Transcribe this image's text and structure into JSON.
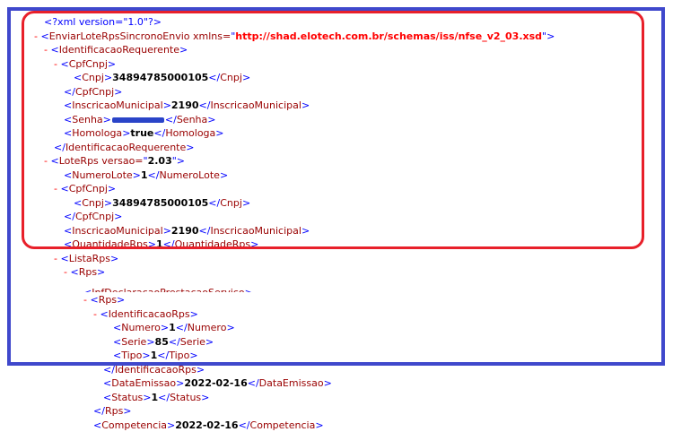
{
  "xml_declaration": "<?xml version=\"1.0\"?>",
  "lines": [
    {
      "indent": 0,
      "minus": false,
      "parts": [
        {
          "t": "pi",
          "v": "<?xml version=\"1.0\"?>"
        }
      ]
    },
    {
      "indent": 0,
      "minus": true,
      "parts": [
        {
          "t": "br",
          "v": "<"
        },
        {
          "t": "tg",
          "v": "EnviarLoteRpsSincronoEnvio"
        },
        {
          "t": "at",
          "v": " xmlns="
        },
        {
          "t": "av",
          "v": "\""
        },
        {
          "t": "avu",
          "v": "http://shad.elotech.com.br/schemas/iss/nfse_v2_03.xsd"
        },
        {
          "t": "av",
          "v": "\""
        },
        {
          "t": "br",
          "v": ">"
        }
      ]
    },
    {
      "indent": 1,
      "minus": true,
      "parts": [
        {
          "t": "br",
          "v": "<"
        },
        {
          "t": "tg",
          "v": "IdentificacaoRequerente"
        },
        {
          "t": "br",
          "v": ">"
        }
      ]
    },
    {
      "indent": 2,
      "minus": true,
      "parts": [
        {
          "t": "br",
          "v": "<"
        },
        {
          "t": "tg",
          "v": "CpfCnpj"
        },
        {
          "t": "br",
          "v": ">"
        }
      ]
    },
    {
      "indent": 3,
      "minus": false,
      "parts": [
        {
          "t": "br",
          "v": "<"
        },
        {
          "t": "tg",
          "v": "Cnpj"
        },
        {
          "t": "br",
          "v": ">"
        },
        {
          "t": "tx",
          "v": "34894785000105"
        },
        {
          "t": "br",
          "v": "</"
        },
        {
          "t": "tg",
          "v": "Cnpj"
        },
        {
          "t": "br",
          "v": ">"
        }
      ]
    },
    {
      "indent": 2,
      "minus": false,
      "parts": [
        {
          "t": "br",
          "v": "</"
        },
        {
          "t": "tg",
          "v": "CpfCnpj"
        },
        {
          "t": "br",
          "v": ">"
        }
      ]
    },
    {
      "indent": 2,
      "minus": false,
      "parts": [
        {
          "t": "br",
          "v": "<"
        },
        {
          "t": "tg",
          "v": "InscricaoMunicipal"
        },
        {
          "t": "br",
          "v": ">"
        },
        {
          "t": "tx",
          "v": "2190"
        },
        {
          "t": "br",
          "v": "</"
        },
        {
          "t": "tg",
          "v": "InscricaoMunicipal"
        },
        {
          "t": "br",
          "v": ">"
        }
      ]
    },
    {
      "indent": 2,
      "minus": false,
      "parts": [
        {
          "t": "br",
          "v": "<"
        },
        {
          "t": "tg",
          "v": "Senha"
        },
        {
          "t": "br",
          "v": ">"
        },
        {
          "t": "mask",
          "v": ""
        },
        {
          "t": "br",
          "v": "</"
        },
        {
          "t": "tg",
          "v": "Senha"
        },
        {
          "t": "br",
          "v": ">"
        }
      ]
    },
    {
      "indent": 2,
      "minus": false,
      "parts": [
        {
          "t": "br",
          "v": "<"
        },
        {
          "t": "tg",
          "v": "Homologa"
        },
        {
          "t": "br",
          "v": ">"
        },
        {
          "t": "tx",
          "v": "true"
        },
        {
          "t": "br",
          "v": "</"
        },
        {
          "t": "tg",
          "v": "Homologa"
        },
        {
          "t": "br",
          "v": ">"
        }
      ]
    },
    {
      "indent": 1,
      "minus": false,
      "parts": [
        {
          "t": "br",
          "v": "</"
        },
        {
          "t": "tg",
          "v": "IdentificacaoRequerente"
        },
        {
          "t": "br",
          "v": ">"
        }
      ]
    },
    {
      "indent": 1,
      "minus": true,
      "parts": [
        {
          "t": "br",
          "v": "<"
        },
        {
          "t": "tg",
          "v": "LoteRps"
        },
        {
          "t": "at",
          "v": " versao="
        },
        {
          "t": "av",
          "v": "\""
        },
        {
          "t": "tx",
          "v": "2.03"
        },
        {
          "t": "av",
          "v": "\""
        },
        {
          "t": "br",
          "v": ">"
        }
      ]
    },
    {
      "indent": 2,
      "minus": false,
      "parts": [
        {
          "t": "br",
          "v": "<"
        },
        {
          "t": "tg",
          "v": "NumeroLote"
        },
        {
          "t": "br",
          "v": ">"
        },
        {
          "t": "tx",
          "v": "1"
        },
        {
          "t": "br",
          "v": "</"
        },
        {
          "t": "tg",
          "v": "NumeroLote"
        },
        {
          "t": "br",
          "v": ">"
        }
      ]
    },
    {
      "indent": 2,
      "minus": true,
      "parts": [
        {
          "t": "br",
          "v": "<"
        },
        {
          "t": "tg",
          "v": "CpfCnpj"
        },
        {
          "t": "br",
          "v": ">"
        }
      ]
    },
    {
      "indent": 3,
      "minus": false,
      "parts": [
        {
          "t": "br",
          "v": "<"
        },
        {
          "t": "tg",
          "v": "Cnpj"
        },
        {
          "t": "br",
          "v": ">"
        },
        {
          "t": "tx",
          "v": "34894785000105"
        },
        {
          "t": "br",
          "v": "</"
        },
        {
          "t": "tg",
          "v": "Cnpj"
        },
        {
          "t": "br",
          "v": ">"
        }
      ]
    },
    {
      "indent": 2,
      "minus": false,
      "parts": [
        {
          "t": "br",
          "v": "</"
        },
        {
          "t": "tg",
          "v": "CpfCnpj"
        },
        {
          "t": "br",
          "v": ">"
        }
      ]
    },
    {
      "indent": 2,
      "minus": false,
      "parts": [
        {
          "t": "br",
          "v": "<"
        },
        {
          "t": "tg",
          "v": "InscricaoMunicipal"
        },
        {
          "t": "br",
          "v": ">"
        },
        {
          "t": "tx",
          "v": "2190"
        },
        {
          "t": "br",
          "v": "</"
        },
        {
          "t": "tg",
          "v": "InscricaoMunicipal"
        },
        {
          "t": "br",
          "v": ">"
        }
      ]
    },
    {
      "indent": 2,
      "minus": false,
      "parts": [
        {
          "t": "br",
          "v": "<"
        },
        {
          "t": "tg",
          "v": "QuantidadeRps"
        },
        {
          "t": "br",
          "v": ">"
        },
        {
          "t": "tx",
          "v": "1"
        },
        {
          "t": "br",
          "v": "</"
        },
        {
          "t": "tg",
          "v": "QuantidadeRps"
        },
        {
          "t": "br",
          "v": ">"
        }
      ]
    },
    {
      "indent": 2,
      "minus": true,
      "parts": [
        {
          "t": "br",
          "v": "<"
        },
        {
          "t": "tg",
          "v": "ListaRps"
        },
        {
          "t": "br",
          "v": ">"
        }
      ]
    },
    {
      "indent": 3,
      "minus": true,
      "parts": [
        {
          "t": "br",
          "v": "<"
        },
        {
          "t": "tg",
          "v": "Rps"
        },
        {
          "t": "br",
          "v": ">"
        }
      ]
    },
    {
      "indent": 4,
      "minus": false,
      "occluded": true,
      "parts": [
        {
          "t": "br",
          "v": "<"
        },
        {
          "t": "tg",
          "v": "InfDeclaracaoPrestacaoServico"
        },
        {
          "t": "br",
          "v": ">"
        }
      ]
    },
    {
      "indent": 5,
      "minus": true,
      "parts": [
        {
          "t": "br",
          "v": "<"
        },
        {
          "t": "tg",
          "v": "Rps"
        },
        {
          "t": "br",
          "v": ">"
        }
      ]
    },
    {
      "indent": 6,
      "minus": true,
      "parts": [
        {
          "t": "br",
          "v": "<"
        },
        {
          "t": "tg",
          "v": "IdentificacaoRps"
        },
        {
          "t": "br",
          "v": ">"
        }
      ]
    },
    {
      "indent": 7,
      "minus": false,
      "parts": [
        {
          "t": "br",
          "v": "<"
        },
        {
          "t": "tg",
          "v": "Numero"
        },
        {
          "t": "br",
          "v": ">"
        },
        {
          "t": "tx",
          "v": "1"
        },
        {
          "t": "br",
          "v": "</"
        },
        {
          "t": "tg",
          "v": "Numero"
        },
        {
          "t": "br",
          "v": ">"
        }
      ]
    },
    {
      "indent": 7,
      "minus": false,
      "parts": [
        {
          "t": "br",
          "v": "<"
        },
        {
          "t": "tg",
          "v": "Serie"
        },
        {
          "t": "br",
          "v": ">"
        },
        {
          "t": "tx",
          "v": "85"
        },
        {
          "t": "br",
          "v": "</"
        },
        {
          "t": "tg",
          "v": "Serie"
        },
        {
          "t": "br",
          "v": ">"
        }
      ]
    },
    {
      "indent": 7,
      "minus": false,
      "parts": [
        {
          "t": "br",
          "v": "<"
        },
        {
          "t": "tg",
          "v": "Tipo"
        },
        {
          "t": "br",
          "v": ">"
        },
        {
          "t": "tx",
          "v": "1"
        },
        {
          "t": "br",
          "v": "</"
        },
        {
          "t": "tg",
          "v": "Tipo"
        },
        {
          "t": "br",
          "v": ">"
        }
      ]
    },
    {
      "indent": 6,
      "minus": false,
      "parts": [
        {
          "t": "br",
          "v": "</"
        },
        {
          "t": "tg",
          "v": "IdentificacaoRps"
        },
        {
          "t": "br",
          "v": ">"
        }
      ]
    },
    {
      "indent": 6,
      "minus": false,
      "parts": [
        {
          "t": "br",
          "v": "<"
        },
        {
          "t": "tg",
          "v": "DataEmissao"
        },
        {
          "t": "br",
          "v": ">"
        },
        {
          "t": "tx",
          "v": "2022-02-16"
        },
        {
          "t": "br",
          "v": "</"
        },
        {
          "t": "tg",
          "v": "DataEmissao"
        },
        {
          "t": "br",
          "v": ">"
        }
      ]
    },
    {
      "indent": 6,
      "minus": false,
      "parts": [
        {
          "t": "br",
          "v": "<"
        },
        {
          "t": "tg",
          "v": "Status"
        },
        {
          "t": "br",
          "v": ">"
        },
        {
          "t": "tx",
          "v": "1"
        },
        {
          "t": "br",
          "v": "</"
        },
        {
          "t": "tg",
          "v": "Status"
        },
        {
          "t": "br",
          "v": ">"
        }
      ]
    },
    {
      "indent": 5,
      "minus": false,
      "parts": [
        {
          "t": "br",
          "v": "</"
        },
        {
          "t": "tg",
          "v": "Rps"
        },
        {
          "t": "br",
          "v": ">"
        }
      ]
    },
    {
      "indent": 5,
      "minus": false,
      "parts": [
        {
          "t": "br",
          "v": "<"
        },
        {
          "t": "tg",
          "v": "Competencia"
        },
        {
          "t": "br",
          "v": ">"
        },
        {
          "t": "tx",
          "v": "2022-02-16"
        },
        {
          "t": "br",
          "v": "</"
        },
        {
          "t": "tg",
          "v": "Competencia"
        },
        {
          "t": "br",
          "v": ">"
        }
      ]
    }
  ],
  "colors": {
    "highlight_red": "#e8202a",
    "frame_blue": "#3f48cc",
    "tag": "#990000",
    "bracket": "#0000ff"
  }
}
